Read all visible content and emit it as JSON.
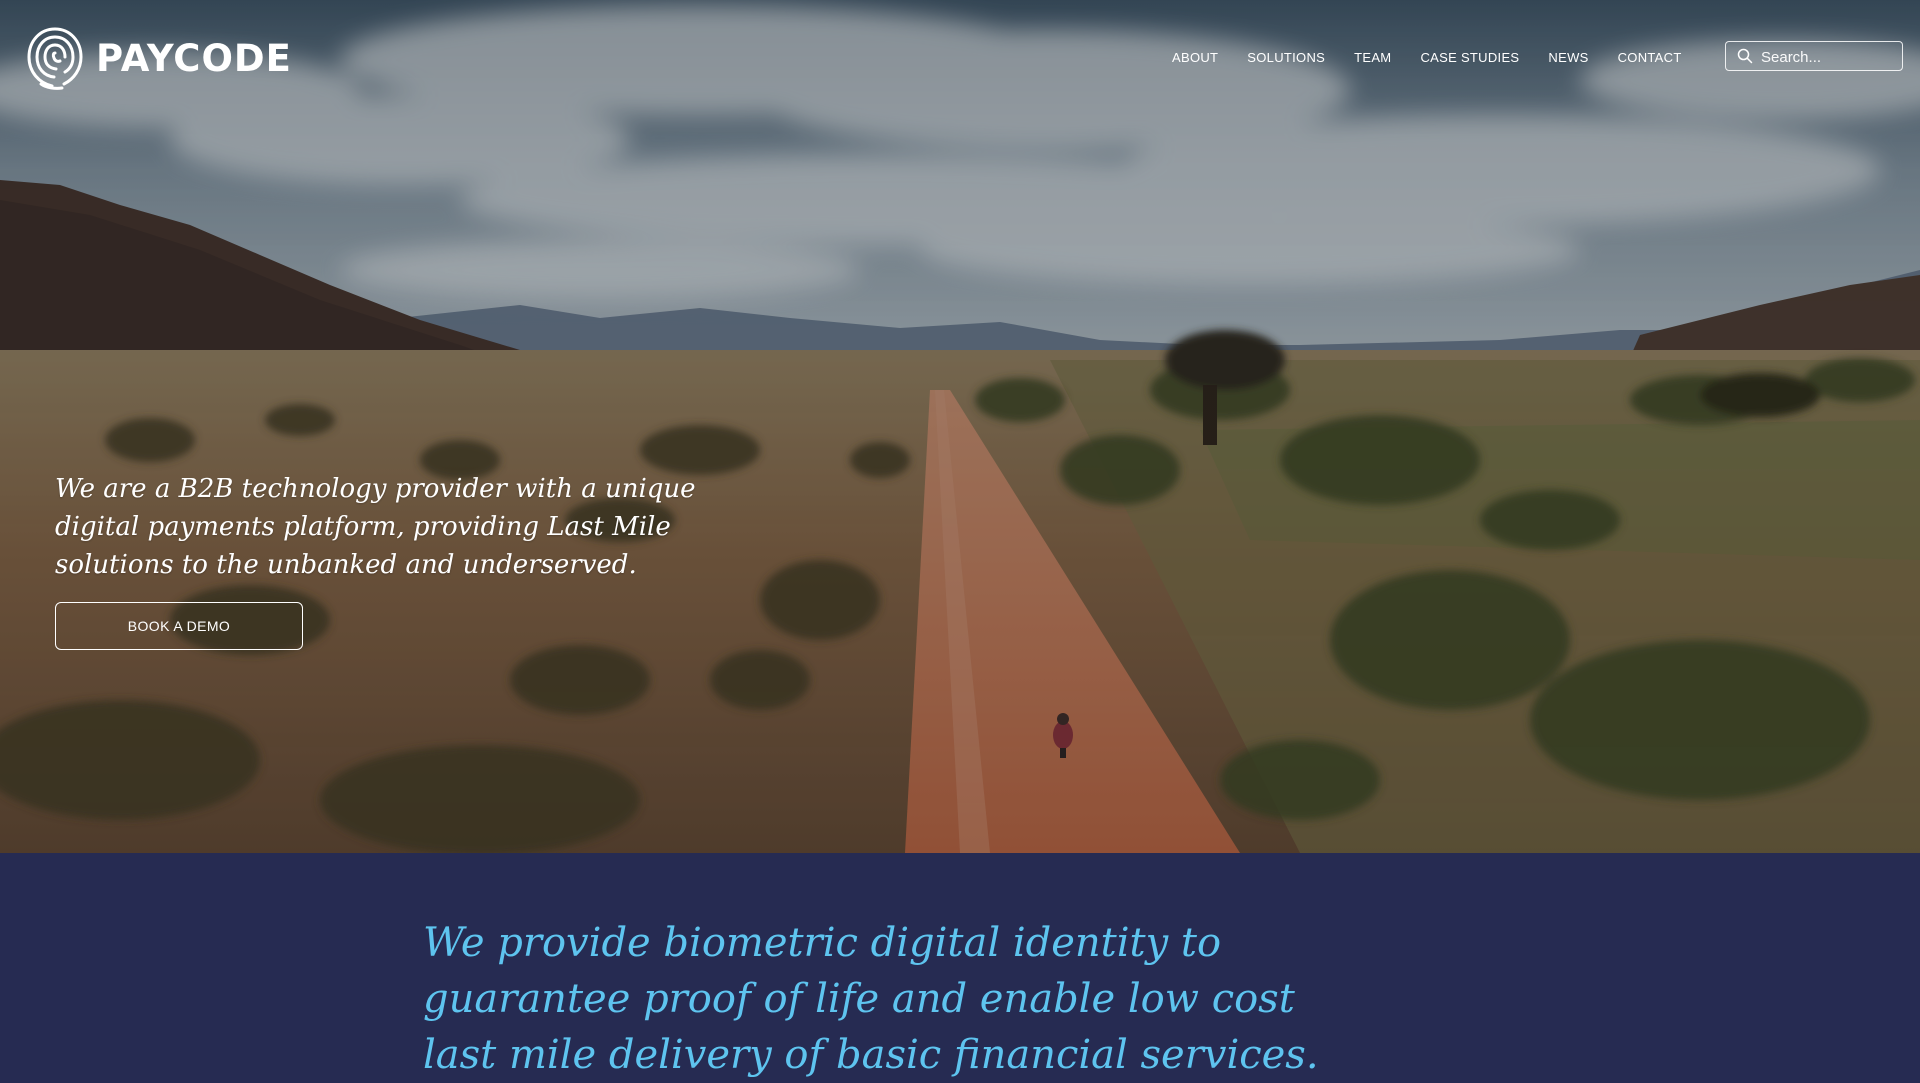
{
  "brand": {
    "name": "PAYCODE",
    "logo_icon": "fingerprint-swirl-icon"
  },
  "nav": {
    "items": [
      {
        "label": "ABOUT"
      },
      {
        "label": "SOLUTIONS"
      },
      {
        "label": "TEAM"
      },
      {
        "label": "CASE STUDIES"
      },
      {
        "label": "NEWS"
      },
      {
        "label": "CONTACT"
      }
    ]
  },
  "search": {
    "placeholder": "Search...",
    "icon": "search-icon"
  },
  "hero": {
    "background": "aerial-savanna-dirt-road-photo",
    "headline": "We are a B2B technology provider with a unique digital payments platform, providing Last Mile solutions to the unbanked and underserved.",
    "cta_label": "BOOK A DEMO"
  },
  "mission": {
    "text": "We provide biometric digital identity to guarantee proof of life and enable low cost last mile delivery of basic financial services."
  },
  "colors": {
    "navy": "#262b52",
    "accent": "#5ec4ef",
    "white": "#ffffff"
  }
}
